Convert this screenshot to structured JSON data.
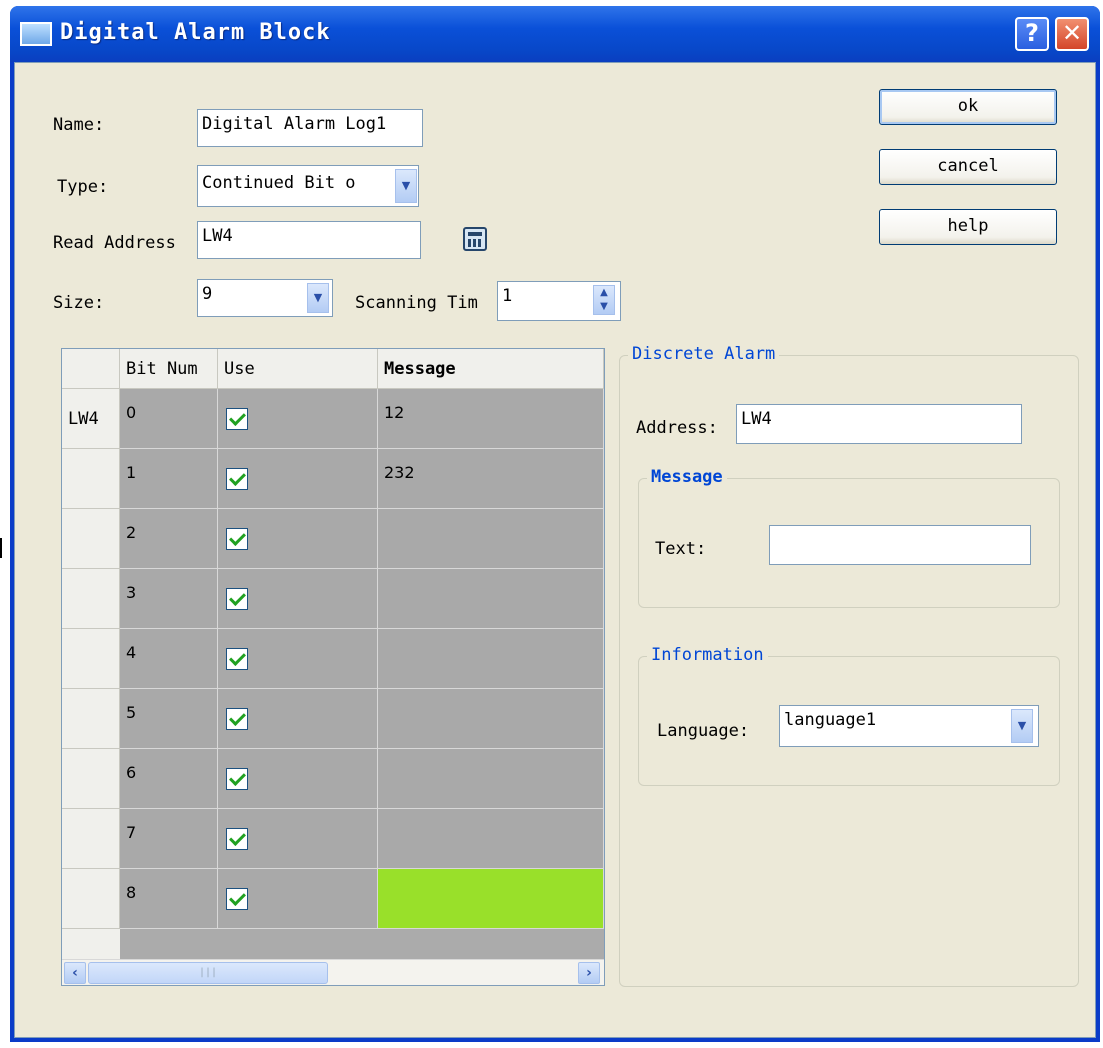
{
  "window": {
    "title": "Digital Alarm Block",
    "help_glyph": "?",
    "close_glyph": "✕"
  },
  "form": {
    "name_label": "Name:",
    "name_value": "Digital Alarm Log1",
    "type_label": "Type:",
    "type_value": "Continued Bit o",
    "read_address_label": "Read Address",
    "read_address_value": "LW4",
    "size_label": "Size:",
    "size_value": "9",
    "scanning_label": "Scanning Tim",
    "scanning_value": "1"
  },
  "buttons": {
    "ok": "ok",
    "cancel": "cancel",
    "help": "help"
  },
  "table": {
    "columns": [
      "Bit Num",
      "Use",
      "Message"
    ],
    "rows": [
      {
        "header": "LW4",
        "bit": "0",
        "use": true,
        "message": "12"
      },
      {
        "header": "",
        "bit": "1",
        "use": true,
        "message": "232"
      },
      {
        "header": "",
        "bit": "2",
        "use": true,
        "message": ""
      },
      {
        "header": "",
        "bit": "3",
        "use": true,
        "message": ""
      },
      {
        "header": "",
        "bit": "4",
        "use": true,
        "message": ""
      },
      {
        "header": "",
        "bit": "5",
        "use": true,
        "message": ""
      },
      {
        "header": "",
        "bit": "6",
        "use": true,
        "message": ""
      },
      {
        "header": "",
        "bit": "7",
        "use": true,
        "message": ""
      },
      {
        "header": "",
        "bit": "8",
        "use": true,
        "message": ""
      }
    ],
    "selected_cell_color": "#99e02a",
    "cell_bg_color": "#a9a9a9"
  },
  "discrete_alarm": {
    "title": "Discrete Alarm",
    "address_label": "Address:",
    "address_value": "LW4",
    "message_group": {
      "title": "Message",
      "text_label": "Text:",
      "text_value": ""
    },
    "information_group": {
      "title": "Information",
      "language_label": "Language:",
      "language_value": "language1"
    }
  },
  "icons": {
    "calculator": "calculator-icon",
    "dropdown": "chevron-down-icon",
    "spinner": "spinner-icon"
  }
}
